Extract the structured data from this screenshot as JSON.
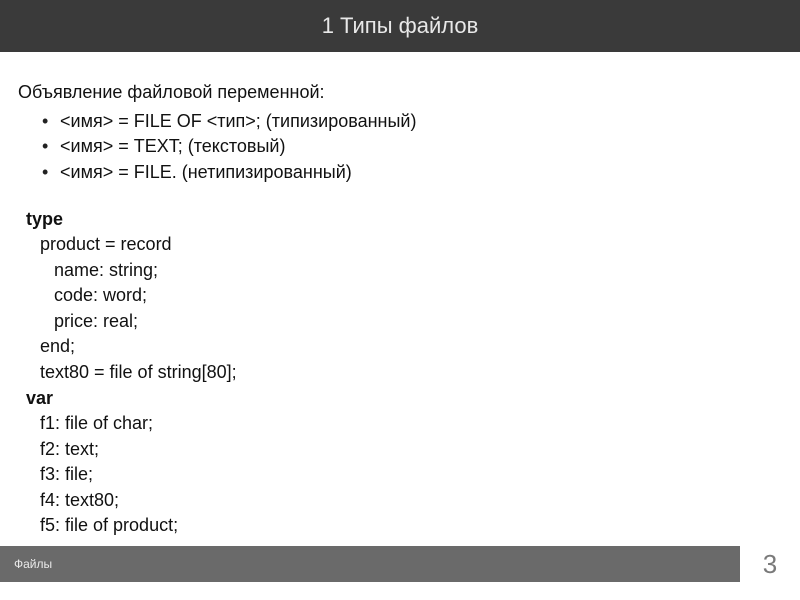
{
  "header": {
    "title": "1 Типы файлов"
  },
  "declaration": {
    "title": "Объявление файловой переменной:",
    "items": [
      "<имя> = FILE OF <тип>;   (типизированный)",
      "<имя> = TEXT;        (текстовый)",
      "<имя> = FILE.        (нетипизированный)"
    ]
  },
  "code": {
    "type_kw": "type",
    "type_lines": [
      "product = record",
      "  name: string;",
      "  code: word;",
      "  price: real;",
      "end;",
      "text80 = file of string[80];"
    ],
    "var_kw": "var",
    "var_lines": [
      "f1: file of char;",
      "f2: text;",
      "f3: file;",
      "f4: text80;",
      "f5: file of product;"
    ]
  },
  "footer": {
    "label": "Файлы",
    "page": "3"
  }
}
